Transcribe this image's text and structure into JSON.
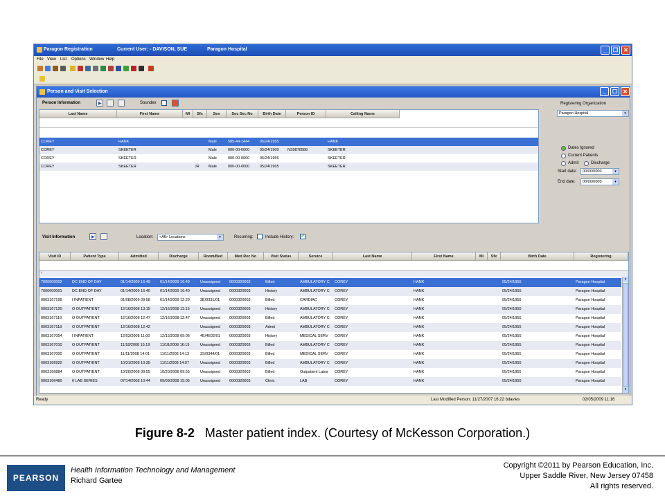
{
  "window": {
    "title": "Paragon Registration",
    "user": "Current User: - DAVISON, SUE",
    "hospital": "Paragon Hospital"
  },
  "menu": [
    "File",
    "View",
    "List",
    "Options",
    "Window",
    "Help"
  ],
  "child": {
    "title": "Person and Visit Selection"
  },
  "person": {
    "section_label": "Person Information",
    "soundex_label": "Soundex",
    "columns": [
      "Last Name",
      "First Name",
      "MI",
      "Sfx",
      "Sex",
      "Soc Sec No",
      "Birth Date",
      "Person ID",
      "Calling Name"
    ],
    "rows": [
      {
        "last": "COREY",
        "first": "HANK",
        "mi": "",
        "sfx": "",
        "sex": "Male",
        "ssn": "585-44-1444",
        "dob": "05/24/1955",
        "pid": "",
        "calling": "HANK"
      },
      {
        "last": "COREY",
        "first": "SKEETER",
        "mi": "",
        "sfx": "",
        "sex": "Male",
        "ssn": "000-00-0000",
        "dob": "05/24/1900",
        "pid": "NS9878588",
        "calling": "SKEETER"
      },
      {
        "last": "COREY",
        "first": "SKEETER",
        "mi": "",
        "sfx": "",
        "sex": "Male",
        "ssn": "000-00-0000",
        "dob": "05/24/1956",
        "pid": "",
        "calling": "SKEETER"
      },
      {
        "last": "COREY",
        "first": "SKEETER",
        "mi": "",
        "sfx": "JR",
        "sex": "Male",
        "ssn": "000-00-0000",
        "dob": "05/24/1965",
        "pid": "",
        "calling": "SKEETER"
      }
    ]
  },
  "org": {
    "label": "Registering Organization",
    "value": "Paragon Hospital",
    "radios": [
      "Dates Ignored",
      "Current Patients",
      "Admit",
      "Discharge"
    ],
    "start_label": "Start date:",
    "start_value": "00/00/0000",
    "end_label": "End date:",
    "end_value": "00/00/0000"
  },
  "visit": {
    "section_label": "Visit Information",
    "location_label": "Location:",
    "location_value": "<All> Locations",
    "recurring_label": "Recurring:",
    "history_label": "Include History:",
    "columns": [
      "Visit ID",
      "Patient Type",
      "Admitted",
      "Discharge",
      "Room/Bed",
      "Med Rec No",
      "Visit Status",
      "Service",
      "Last Name",
      "First Name",
      "MI",
      "Sfx",
      "Birth Date",
      "Registering"
    ],
    "rows": [
      [
        "7000000002",
        "DC END OF DAY",
        "01/14/2009 16:49",
        "01/14/2009 16:49",
        "Unassigned",
        "0000320003",
        "Billed",
        "AMBULATORY C",
        "COREY",
        "HANK",
        "05/24/1955",
        "Paragon Hospital"
      ],
      [
        "7000000001",
        "DC END OF DAY",
        "01/14/2009 16:40",
        "01/14/2009 16:40",
        "Unassigned",
        "0000320003",
        "History",
        "AMBULATORY C",
        "COREY",
        "HANK",
        "05/24/1955",
        "Paragon Hospital"
      ],
      [
        "0003167199",
        "I INPATIENT",
        "01/08/2009 09:58",
        "01/14/2009 12:20",
        "3E/0331/01",
        "0000320003",
        "Billed",
        "CARDIAC",
        "COREY",
        "HANK",
        "05/24/1955",
        "Paragon Hospital"
      ],
      [
        "0003167120",
        "O OUTPATIENT",
        "12/16/2008 13:15",
        "12/16/2008 13:15",
        "Unassigned",
        "0000320003",
        "History",
        "AMBULATORY C",
        "COREY",
        "HANK",
        "05/24/1955",
        "Paragon Hospital"
      ],
      [
        "0003167119",
        "O OUTPATIENT",
        "12/16/2008 12:47",
        "12/16/2008 12:47",
        "Unassigned",
        "0000320003",
        "Billed",
        "AMBULATORY C",
        "COREY",
        "HANK",
        "05/24/1955",
        "Paragon Hospital"
      ],
      [
        "0003167118",
        "O OUTPATIENT",
        "12/16/2008 12:42",
        "",
        "Unassigned",
        "0000320003",
        "Admit",
        "AMBULATORY C",
        "COREY",
        "HANK",
        "05/24/1955",
        "Paragon Hospital"
      ],
      [
        "0003167054",
        "I INPATIENT",
        "12/03/2008 11:00",
        "12/15/2008 09:06",
        "4E/4E02/01",
        "0000320003",
        "History",
        "MEDICAL SERV",
        "COREY",
        "HANK",
        "05/24/1955",
        "Paragon Hospital"
      ],
      [
        "0003167010",
        "O OUTPATIENT",
        "11/18/2008 15:19",
        "11/18/2008 16:19",
        "Unassigned",
        "0000320003",
        "Billed",
        "AMBULATORY C",
        "COREY",
        "HANK",
        "05/24/1955",
        "Paragon Hospital"
      ],
      [
        "0003167000",
        "O OUTPATIENT",
        "11/11/2008 14:01",
        "11/11/2008 14:13",
        "3S/0344/01",
        "0000320003",
        "Billed",
        "MEDICAL SERV",
        "COREY",
        "HANK",
        "05/24/1955",
        "Paragon Hospital"
      ],
      [
        "0003166922",
        "O OUTPATIENT",
        "10/31/2008 10:35",
        "11/11/2008 14:07",
        "Unassigned",
        "0000320003",
        "Billed",
        "AMBULATORY C",
        "COREY",
        "HANK",
        "05/24/1955",
        "Paragon Hospital"
      ],
      [
        "0003166884",
        "O OUTPATIENT",
        "10/20/2008 09:55",
        "10/20/2008 09:55",
        "Unassigned",
        "0000320003",
        "Billed",
        "Outpatient Labor",
        "COREY",
        "HANK",
        "05/24/1955",
        "Paragon Hospital"
      ],
      [
        "0003166480",
        "6 LAB SERIES",
        "07/14/2008 10:44",
        "09/09/2008 15:05",
        "Unassigned",
        "0000320003",
        "Clinic",
        "LAB",
        "COREY",
        "HANK",
        "05/24/1955",
        "Paragon Hospital"
      ]
    ]
  },
  "status": {
    "left": "Ready",
    "modified": "Last Modified Person: 11/27/2007 16:22  bdavies",
    "date": "02/05/2009 11:16"
  },
  "caption": {
    "fig": "Figure 8-2",
    "text": "Master patient index. (Courtesy of McKesson Corporation.)"
  },
  "footer": {
    "logo": "PEARSON",
    "book": "Health Information Technology and Management",
    "author": "Richard Gartee",
    "copy1": "Copyright ©2011 by Pearson Education, Inc.",
    "copy2": "Upper Saddle River, New Jersey 07458",
    "copy3": "All rights reserved."
  },
  "colors": {
    "titlebar": "#1f4fb5",
    "selection": "#3a6fd4",
    "logo": "#1d4e86"
  }
}
